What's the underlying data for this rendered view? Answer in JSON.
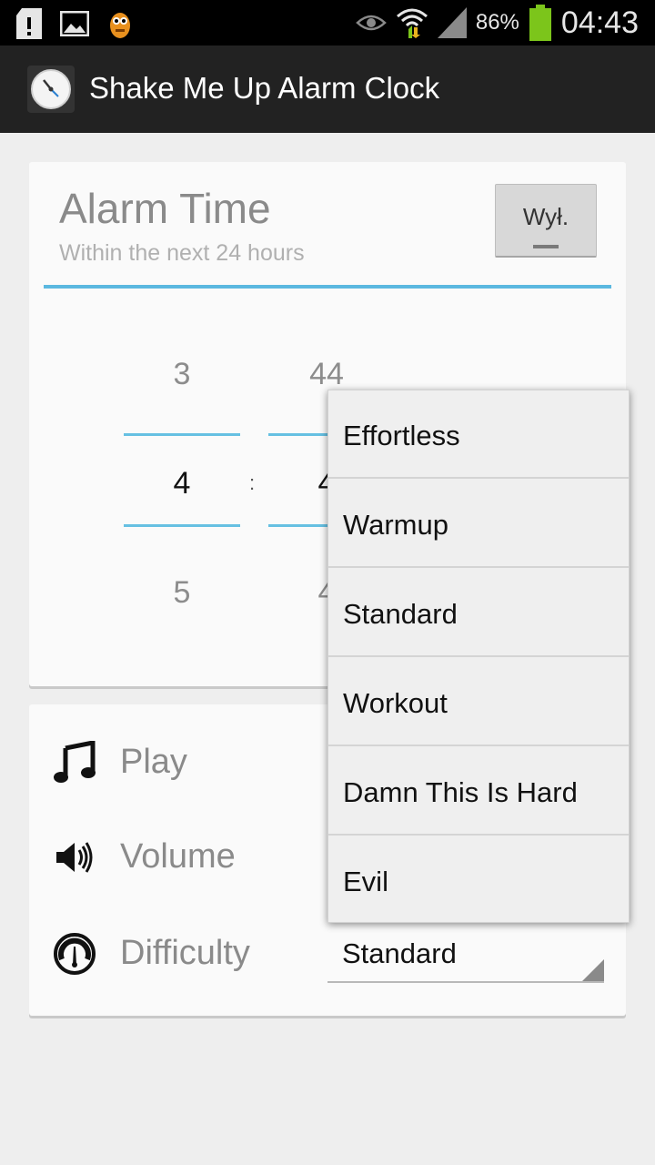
{
  "status_bar": {
    "battery": "86%",
    "time": "04:43",
    "icons": [
      "sd-card-alert-icon",
      "image-icon",
      "monster-app-icon",
      "eye-icon",
      "wifi-icon",
      "signal-icon",
      "battery-icon"
    ]
  },
  "app": {
    "title": "Shake Me Up Alarm Clock",
    "icon": "clock-icon"
  },
  "alarm": {
    "title": "Alarm Time",
    "subtitle": "Within the next 24 hours",
    "toggle_label": "Wył.",
    "hour": {
      "prev": "3",
      "current": "4",
      "next": "5"
    },
    "separator": ":",
    "minute": {
      "prev": "44",
      "current": "4",
      "next": "4"
    }
  },
  "options": {
    "play_label": "Play",
    "volume_label": "Volume",
    "difficulty_label": "Difficulty",
    "difficulty_value": "Standard"
  },
  "dropdown": {
    "items": [
      "Effortless",
      "Warmup",
      "Standard",
      "Workout",
      "Damn This Is Hard",
      "Evil"
    ]
  },
  "colors": {
    "accent": "#5bb8e0",
    "action_bar": "#222222",
    "battery": "#7cc51b"
  }
}
